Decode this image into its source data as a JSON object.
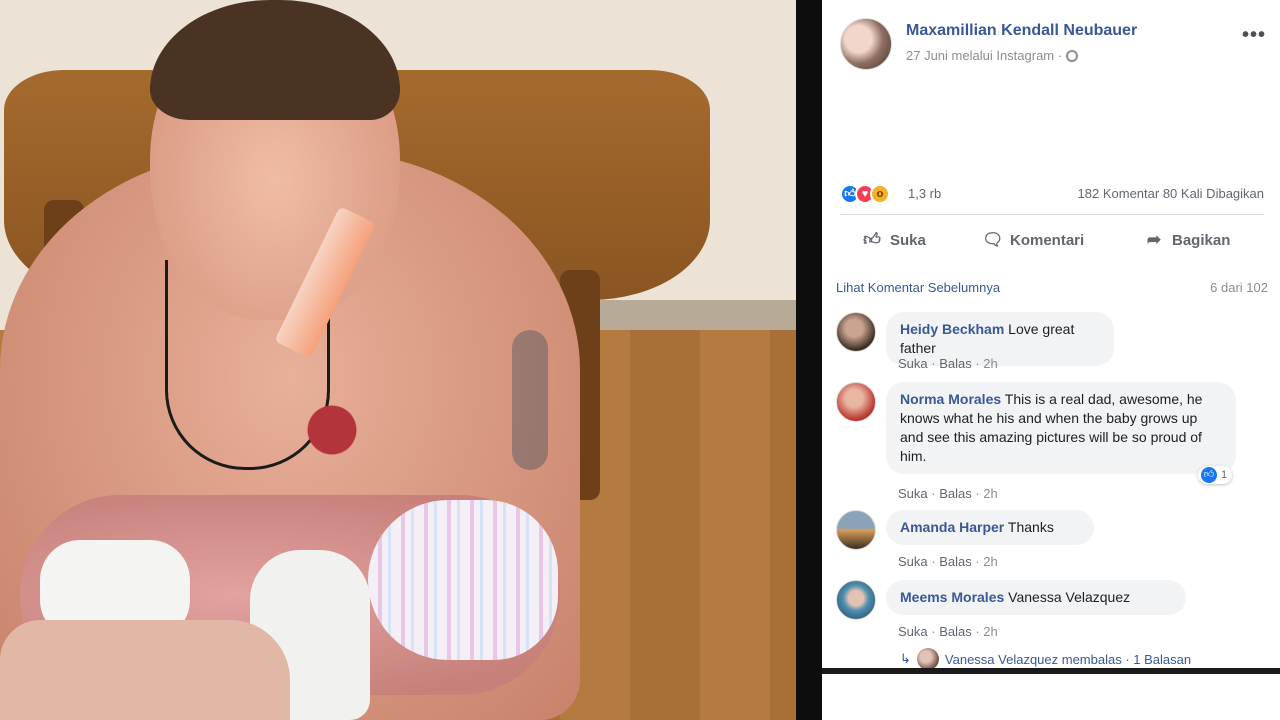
{
  "post": {
    "author": "Maxamillian Kendall Neubauer",
    "meta": "27 Juni melalui Instagram ·",
    "more": "•••"
  },
  "stats": {
    "reaction_count": "1,3 rb",
    "comments_shares": "182 Komentar  80 Kali Dibagikan",
    "reaction_icons": [
      "like-icon",
      "love-icon",
      "wow-icon"
    ]
  },
  "actions": {
    "like": "Suka",
    "comment": "Komentari",
    "share": "Bagikan"
  },
  "comments_header": {
    "view_previous": "Lihat Komentar Sebelumnya",
    "count": "6 dari 102"
  },
  "comments": [
    {
      "name": "Heidy Beckham",
      "text": "Love great father",
      "like": "Suka",
      "reply": "Balas",
      "time": "2h"
    },
    {
      "name": "Norma Morales",
      "text": "This is a real dad, awesome, he knows what he his and when the baby grows up and see this amazing pictures will be so proud of him.",
      "like": "Suka",
      "reply": "Balas",
      "time": "2h",
      "likes": "1"
    },
    {
      "name": "Amanda Harper",
      "text": "Thanks",
      "like": "Suka",
      "reply": "Balas",
      "time": "2h"
    },
    {
      "name": "Meems Morales",
      "text": "Vanessa Velazquez",
      "like": "Suka",
      "reply": "Balas",
      "time": "2h"
    }
  ],
  "reply_summary": "Vanessa Velazquez membalas · 1 Balasan",
  "colors": {
    "link_blue": "#385898",
    "like_blue": "#1877f2",
    "love_red": "#f33e58",
    "wow_yellow": "#f7b125",
    "bubble_bg": "#f2f3f5"
  }
}
